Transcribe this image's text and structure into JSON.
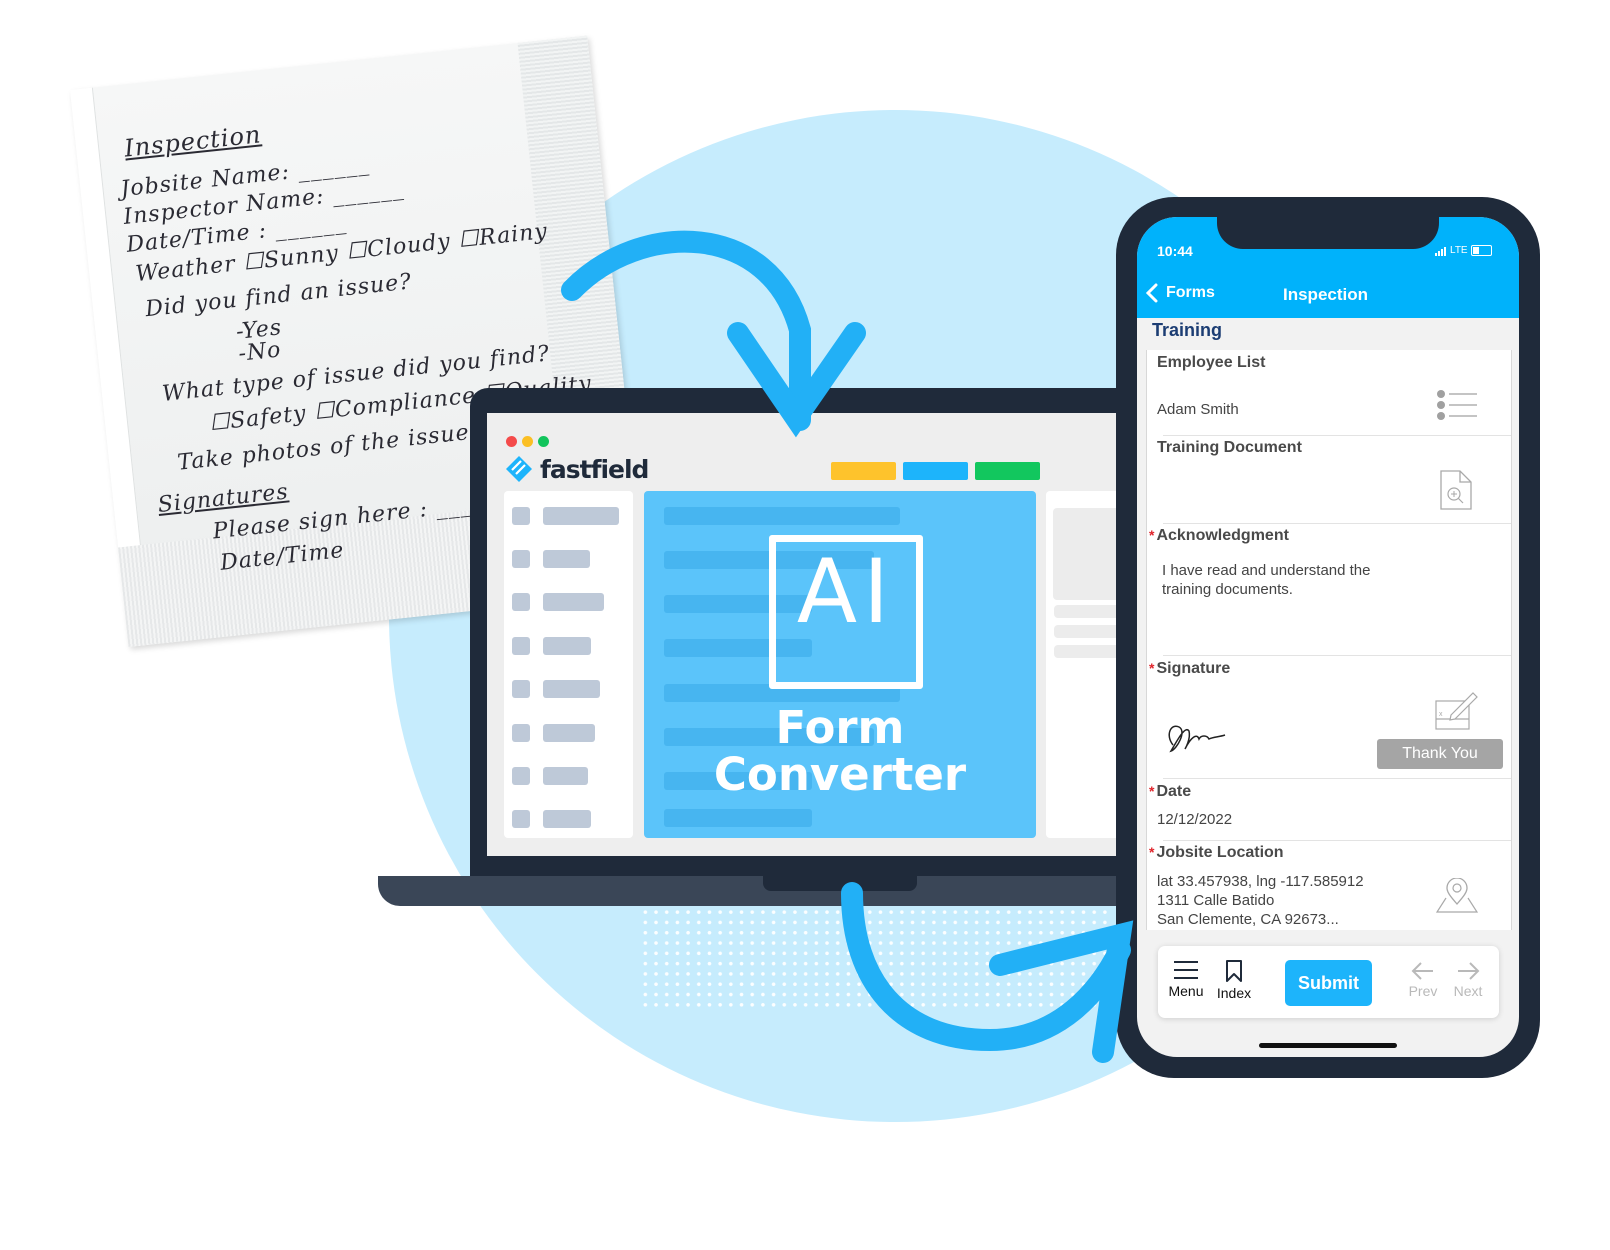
{
  "napkin": {
    "lines": [
      "Inspection",
      "Jobsite Name: ______",
      "Inspector Name: ______",
      "Date/Time : ______",
      "Weather ☐Sunny ☐Cloudy ☐Rainy",
      "Did you find an issue?",
      "-Yes",
      "-No",
      "What type of issue did you find?",
      "☐Safety ☐Compliance ☐Quality",
      "Take photos of the issue",
      "Signatures",
      "Please sign here : ____",
      "Date/Time"
    ]
  },
  "laptop": {
    "window_dots": [
      "#f44a4a",
      "#fbbf24",
      "#12c45c"
    ],
    "brand": "fastfield",
    "brand_icon": "fastfield-logo-icon",
    "toolbar_colors": [
      "#fec32c",
      "#1db4fb",
      "#12c75e"
    ],
    "ai_label": "AI",
    "title_line1": "Form",
    "title_line2": "Converter"
  },
  "phone": {
    "status": {
      "time": "10:44",
      "network": "LTE"
    },
    "nav": {
      "back_label": "Forms",
      "title": "Inspection"
    },
    "section": "Training",
    "fields": [
      {
        "label": "Employee List",
        "required": false,
        "value": "Adam Smith",
        "icon": "list-icon"
      },
      {
        "label": "Training Document",
        "required": false,
        "value": "",
        "icon": "document-zoom-icon"
      },
      {
        "label": "Acknowledgment",
        "required": true,
        "value": "I have read and understand the training documents.",
        "button": "Thank You"
      },
      {
        "label": "Signature",
        "required": true,
        "value": "",
        "icon": "signature-pad-icon"
      },
      {
        "label": "Date",
        "required": true,
        "value": "12/12/2022"
      },
      {
        "label": "Jobsite Location",
        "required": true,
        "value_lines": [
          "lat 33.457938, lng -117.585912",
          "1311 Calle Batido",
          "San Clemente, CA  92673..."
        ],
        "icon": "map-pin-icon"
      }
    ],
    "required_marker": "*",
    "bottom_bar": {
      "menu": "Menu",
      "index": "Index",
      "submit": "Submit",
      "prev": "Prev",
      "next": "Next"
    }
  },
  "colors": {
    "accent": "#1db4fb",
    "arrow": "#22b0f6",
    "circle": "#c6ecfd",
    "dark": "#1f2a3a"
  }
}
